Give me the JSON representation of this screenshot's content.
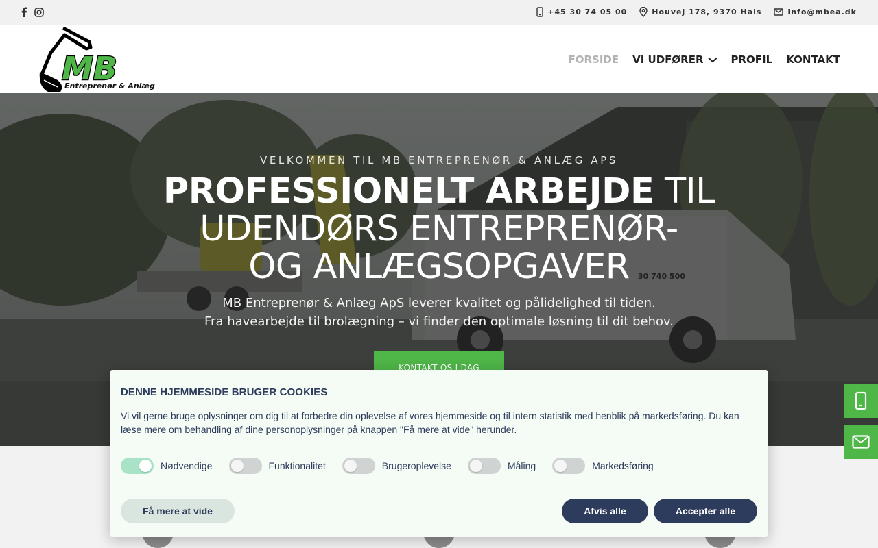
{
  "topbar": {
    "social": [
      {
        "icon": "facebook-icon"
      },
      {
        "icon": "instagram-icon"
      }
    ],
    "phone": "+45 30 74 05 00",
    "address": "Houvej 178, 9370 Hals",
    "email": "info@mbea.dk"
  },
  "header": {
    "logo_letters": "MB",
    "logo_tagline": "Entreprenør & Anlæg",
    "nav": [
      {
        "label": "FORSIDE",
        "active": true
      },
      {
        "label": "VI UDFØRER",
        "dropdown": true
      },
      {
        "label": "PROFIL"
      },
      {
        "label": "KONTAKT"
      }
    ]
  },
  "hero": {
    "kicker": "VELKOMMEN TIL MB ENTREPRENØR & ANLÆG APS",
    "title_bold": "PROFESSIONELT ARBEJDE",
    "title_rest1": " TIL",
    "title_line2": "UDENDØRS ENTREPRENØR-",
    "title_line3": "OG ANLÆGSOPGAVER",
    "sub_line1": "MB Entreprenør & Anlæg ApS leverer kvalitet og pålidelighed til tiden.",
    "sub_line2": "Fra havearbejde til brolægning – vi finder den optimale løsning til dit behov.",
    "cta": "KONTAKT OS I DAG",
    "van_phone": "30 740 500"
  },
  "sidetabs": [
    {
      "icon": "mobile-phone-icon"
    },
    {
      "icon": "envelope-icon"
    }
  ],
  "cookie": {
    "title": "DENNE HJEMMESIDE BRUGER COOKIES",
    "text": "Vi vil gerne bruge oplysninger om dig til at forbedre din oplevelse af vores hjemmeside og til intern statistik med henblik på markedsføring. Du kan læse mere om behandling af dine personoplysninger på knappen \"Få mere at vide\" herunder.",
    "toggles": [
      {
        "label": "Nødvendige",
        "on": true
      },
      {
        "label": "Funktionalitet",
        "on": false
      },
      {
        "label": "Brugeroplevelse",
        "on": false
      },
      {
        "label": "Måling",
        "on": false
      },
      {
        "label": "Markedsføring",
        "on": false
      }
    ],
    "more_label": "Få mere at vide",
    "reject_label": "Afvis alle",
    "accept_label": "Accepter alle"
  },
  "colors": {
    "brand_green": "#4fb648",
    "cookie_navy": "#2d3b5c",
    "cookie_bg": "#f4fcf5"
  }
}
